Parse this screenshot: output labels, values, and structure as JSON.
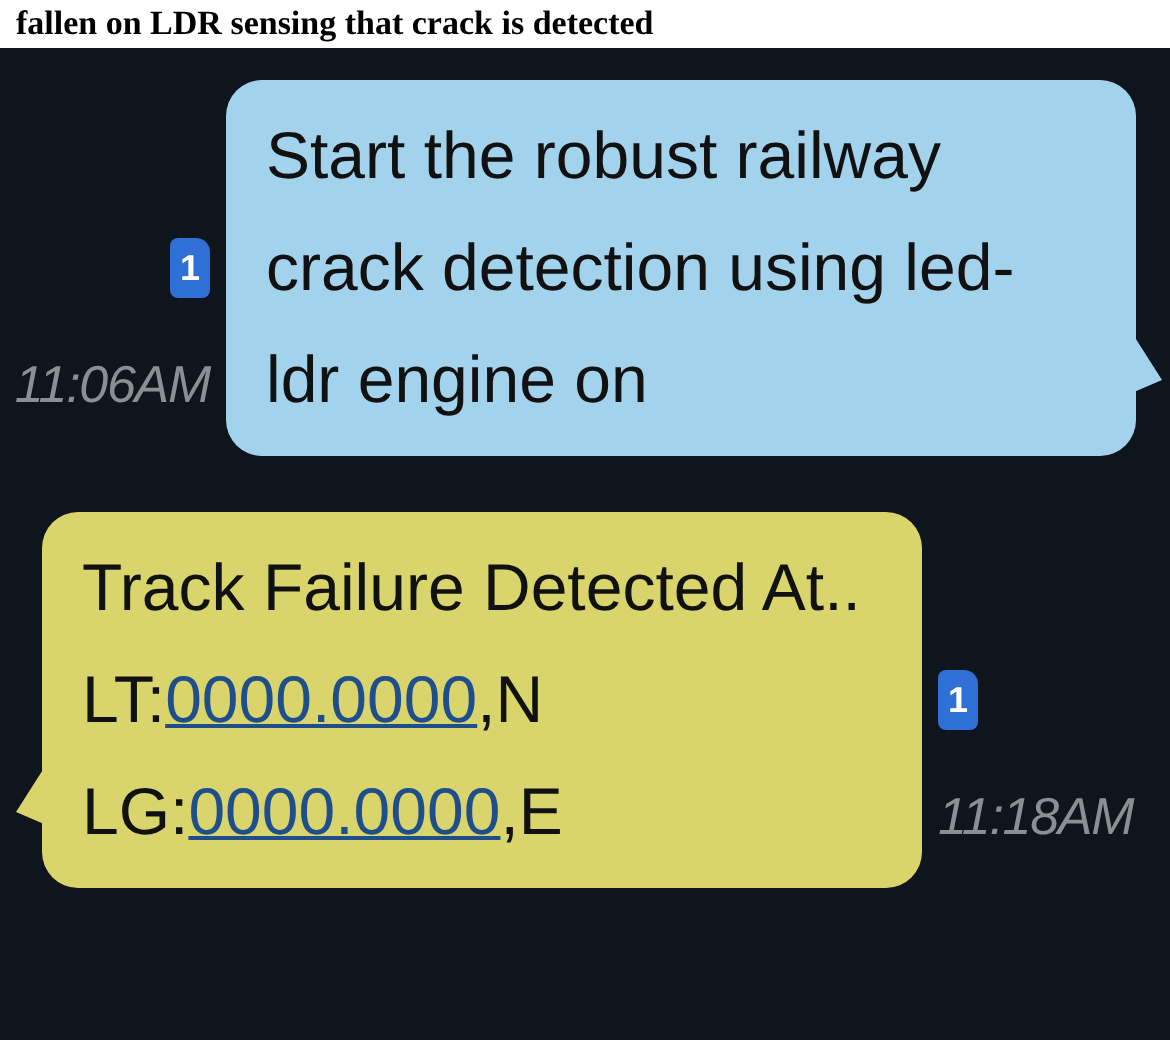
{
  "caption": "fallen on LDR sensing that crack is detected",
  "messages": [
    {
      "kind": "sent",
      "sim": "1",
      "time": "11:06AM",
      "lines": [
        [
          {
            "text": "Start the robust railway",
            "link": false
          }
        ],
        [
          {
            "text": "crack detection using led-",
            "link": false
          }
        ],
        [
          {
            "text": "ldr engine on",
            "link": false
          }
        ]
      ]
    },
    {
      "kind": "received",
      "sim": "1",
      "time": "11:18AM",
      "lines": [
        [
          {
            "text": "Track Failure Detected At..",
            "link": false
          }
        ],
        [
          {
            "text": "LT:",
            "link": false
          },
          {
            "text": "0000.0000",
            "link": true
          },
          {
            "text": ",N",
            "link": false
          }
        ],
        [
          {
            "text": "LG:",
            "link": false
          },
          {
            "text": "0000.0000",
            "link": true
          },
          {
            "text": ",E",
            "link": false
          }
        ]
      ]
    }
  ]
}
